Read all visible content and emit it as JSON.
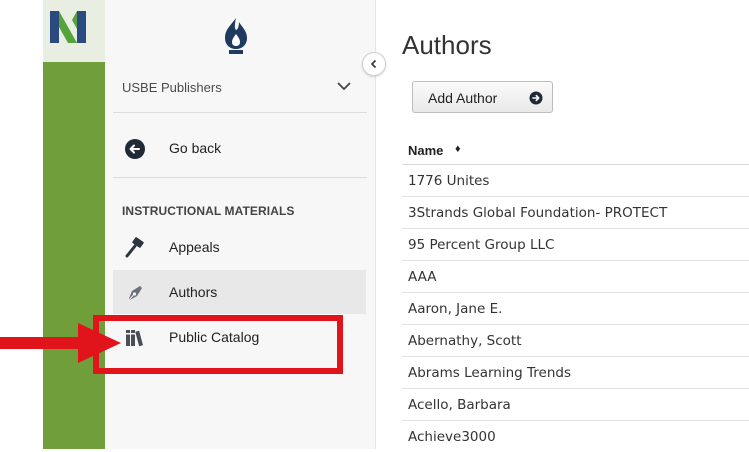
{
  "sidebar": {
    "org_name": "USBE Publishers",
    "go_back_label": "Go back",
    "section_heading": "INSTRUCTIONAL MATERIALS",
    "items": [
      {
        "label": "Appeals",
        "icon": "gavel-icon"
      },
      {
        "label": "Authors",
        "icon": "pen-nib-icon",
        "active": true
      },
      {
        "label": "Public Catalog",
        "icon": "books-icon"
      }
    ]
  },
  "main": {
    "title": "Authors",
    "add_button_label": "Add Author",
    "table": {
      "column_header": "Name",
      "sort_glyph": "♦",
      "rows": [
        "1776 Unites",
        "3Strands Global Foundation- PROTECT",
        "95 Percent Group LLC",
        "AAA",
        "Aaron, Jane E.",
        "Abernathy, Scott",
        "Abrams Learning Trends",
        "Acello, Barbara",
        "Achieve3000"
      ]
    }
  },
  "colors": {
    "rail_green": "#6f9e3b",
    "annotation_red": "#e1141b",
    "logo_blue": "#2b4b80",
    "logo_green": "#57a33b"
  }
}
